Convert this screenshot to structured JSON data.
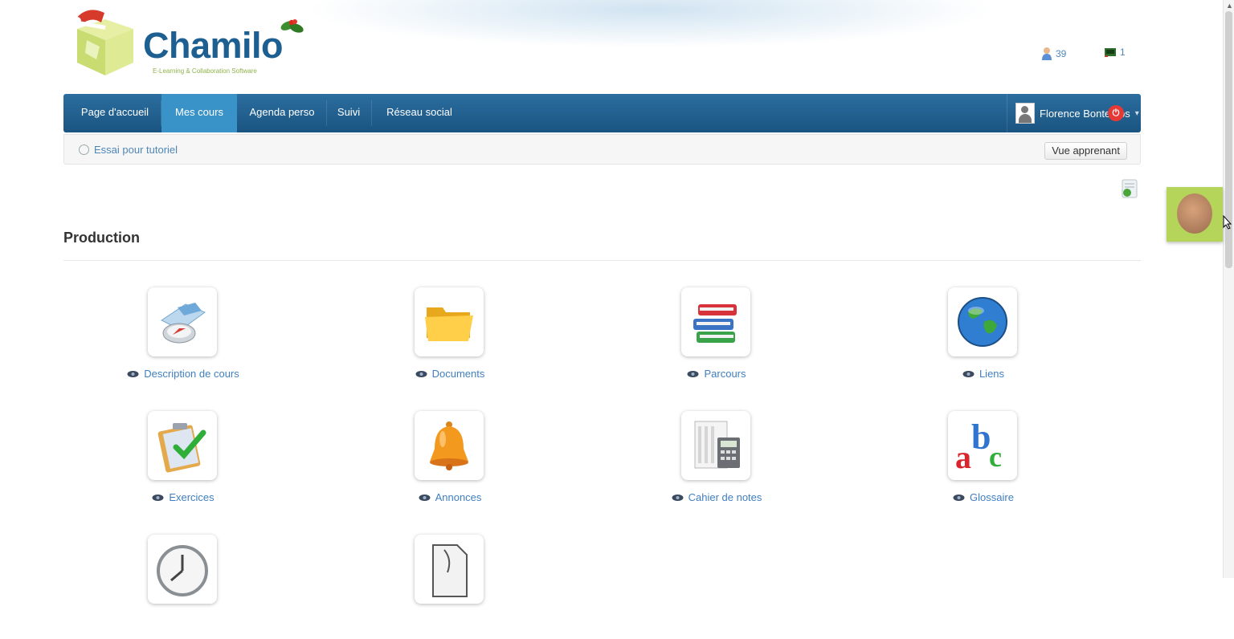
{
  "header": {
    "logo_text": "Chamilo",
    "logo_tagline": "E-Learning & Collaboration Software",
    "users_online_count": "39",
    "messages_count": "1"
  },
  "nav": {
    "items": [
      {
        "label": "Page d'accueil"
      },
      {
        "label": "Mes cours"
      },
      {
        "label": "Agenda perso"
      },
      {
        "label": "Suivi"
      },
      {
        "label": "Réseau social"
      }
    ],
    "active": "Mes cours",
    "user_name": "Florence Bontemps"
  },
  "breadcrumb": {
    "course": "Essai pour tutoriel",
    "student_view_button": "Vue apprenant"
  },
  "section": {
    "title": "Production"
  },
  "tools": [
    {
      "label": "Description de cours",
      "icon": "course-description-icon"
    },
    {
      "label": "Documents",
      "icon": "folder-icon"
    },
    {
      "label": "Parcours",
      "icon": "books-icon"
    },
    {
      "label": "Liens",
      "icon": "globe-icon"
    },
    {
      "label": "Exercices",
      "icon": "exercises-icon"
    },
    {
      "label": "Annonces",
      "icon": "bell-icon"
    },
    {
      "label": "Cahier de notes",
      "icon": "gradebook-icon"
    },
    {
      "label": "Glossaire",
      "icon": "glossary-icon"
    },
    {
      "label": "",
      "icon": "clock-icon"
    },
    {
      "label": "",
      "icon": "document-icon"
    }
  ],
  "colors": {
    "navbar": "#1a5481",
    "nav_active": "#3a93c8",
    "link": "#3f7fc0",
    "logo": "#1d5f91"
  }
}
